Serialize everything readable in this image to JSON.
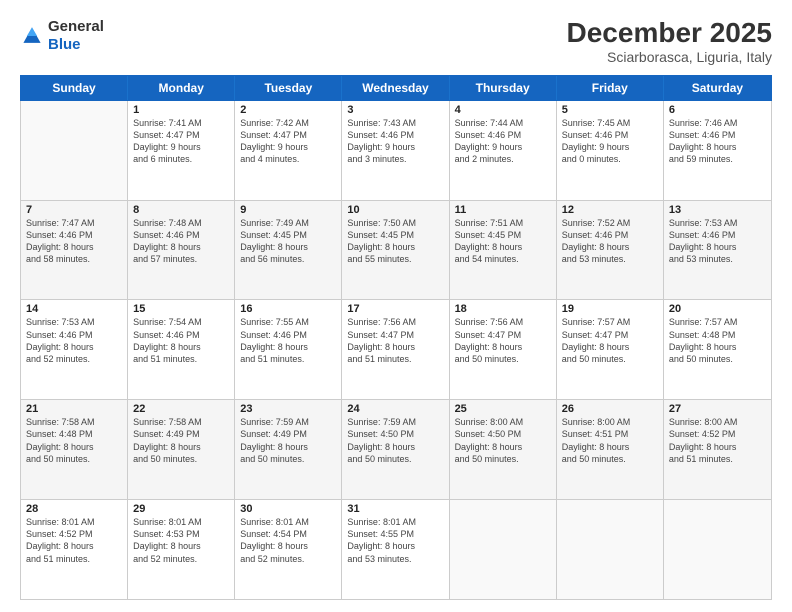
{
  "header": {
    "logo_general": "General",
    "logo_blue": "Blue",
    "month_year": "December 2025",
    "location": "Sciarborasca, Liguria, Italy"
  },
  "days_of_week": [
    "Sunday",
    "Monday",
    "Tuesday",
    "Wednesday",
    "Thursday",
    "Friday",
    "Saturday"
  ],
  "weeks": [
    [
      {
        "day": "",
        "text": "",
        "shaded": false,
        "empty": true
      },
      {
        "day": "1",
        "text": "Sunrise: 7:41 AM\nSunset: 4:47 PM\nDaylight: 9 hours\nand 6 minutes.",
        "shaded": false
      },
      {
        "day": "2",
        "text": "Sunrise: 7:42 AM\nSunset: 4:47 PM\nDaylight: 9 hours\nand 4 minutes.",
        "shaded": false
      },
      {
        "day": "3",
        "text": "Sunrise: 7:43 AM\nSunset: 4:46 PM\nDaylight: 9 hours\nand 3 minutes.",
        "shaded": false
      },
      {
        "day": "4",
        "text": "Sunrise: 7:44 AM\nSunset: 4:46 PM\nDaylight: 9 hours\nand 2 minutes.",
        "shaded": false
      },
      {
        "day": "5",
        "text": "Sunrise: 7:45 AM\nSunset: 4:46 PM\nDaylight: 9 hours\nand 0 minutes.",
        "shaded": false
      },
      {
        "day": "6",
        "text": "Sunrise: 7:46 AM\nSunset: 4:46 PM\nDaylight: 8 hours\nand 59 minutes.",
        "shaded": false
      }
    ],
    [
      {
        "day": "7",
        "text": "Sunrise: 7:47 AM\nSunset: 4:46 PM\nDaylight: 8 hours\nand 58 minutes.",
        "shaded": true
      },
      {
        "day": "8",
        "text": "Sunrise: 7:48 AM\nSunset: 4:46 PM\nDaylight: 8 hours\nand 57 minutes.",
        "shaded": true
      },
      {
        "day": "9",
        "text": "Sunrise: 7:49 AM\nSunset: 4:45 PM\nDaylight: 8 hours\nand 56 minutes.",
        "shaded": true
      },
      {
        "day": "10",
        "text": "Sunrise: 7:50 AM\nSunset: 4:45 PM\nDaylight: 8 hours\nand 55 minutes.",
        "shaded": true
      },
      {
        "day": "11",
        "text": "Sunrise: 7:51 AM\nSunset: 4:45 PM\nDaylight: 8 hours\nand 54 minutes.",
        "shaded": true
      },
      {
        "day": "12",
        "text": "Sunrise: 7:52 AM\nSunset: 4:46 PM\nDaylight: 8 hours\nand 53 minutes.",
        "shaded": true
      },
      {
        "day": "13",
        "text": "Sunrise: 7:53 AM\nSunset: 4:46 PM\nDaylight: 8 hours\nand 53 minutes.",
        "shaded": true
      }
    ],
    [
      {
        "day": "14",
        "text": "Sunrise: 7:53 AM\nSunset: 4:46 PM\nDaylight: 8 hours\nand 52 minutes.",
        "shaded": false
      },
      {
        "day": "15",
        "text": "Sunrise: 7:54 AM\nSunset: 4:46 PM\nDaylight: 8 hours\nand 51 minutes.",
        "shaded": false
      },
      {
        "day": "16",
        "text": "Sunrise: 7:55 AM\nSunset: 4:46 PM\nDaylight: 8 hours\nand 51 minutes.",
        "shaded": false
      },
      {
        "day": "17",
        "text": "Sunrise: 7:56 AM\nSunset: 4:47 PM\nDaylight: 8 hours\nand 51 minutes.",
        "shaded": false
      },
      {
        "day": "18",
        "text": "Sunrise: 7:56 AM\nSunset: 4:47 PM\nDaylight: 8 hours\nand 50 minutes.",
        "shaded": false
      },
      {
        "day": "19",
        "text": "Sunrise: 7:57 AM\nSunset: 4:47 PM\nDaylight: 8 hours\nand 50 minutes.",
        "shaded": false
      },
      {
        "day": "20",
        "text": "Sunrise: 7:57 AM\nSunset: 4:48 PM\nDaylight: 8 hours\nand 50 minutes.",
        "shaded": false
      }
    ],
    [
      {
        "day": "21",
        "text": "Sunrise: 7:58 AM\nSunset: 4:48 PM\nDaylight: 8 hours\nand 50 minutes.",
        "shaded": true
      },
      {
        "day": "22",
        "text": "Sunrise: 7:58 AM\nSunset: 4:49 PM\nDaylight: 8 hours\nand 50 minutes.",
        "shaded": true
      },
      {
        "day": "23",
        "text": "Sunrise: 7:59 AM\nSunset: 4:49 PM\nDaylight: 8 hours\nand 50 minutes.",
        "shaded": true
      },
      {
        "day": "24",
        "text": "Sunrise: 7:59 AM\nSunset: 4:50 PM\nDaylight: 8 hours\nand 50 minutes.",
        "shaded": true
      },
      {
        "day": "25",
        "text": "Sunrise: 8:00 AM\nSunset: 4:50 PM\nDaylight: 8 hours\nand 50 minutes.",
        "shaded": true
      },
      {
        "day": "26",
        "text": "Sunrise: 8:00 AM\nSunset: 4:51 PM\nDaylight: 8 hours\nand 50 minutes.",
        "shaded": true
      },
      {
        "day": "27",
        "text": "Sunrise: 8:00 AM\nSunset: 4:52 PM\nDaylight: 8 hours\nand 51 minutes.",
        "shaded": true
      }
    ],
    [
      {
        "day": "28",
        "text": "Sunrise: 8:01 AM\nSunset: 4:52 PM\nDaylight: 8 hours\nand 51 minutes.",
        "shaded": false
      },
      {
        "day": "29",
        "text": "Sunrise: 8:01 AM\nSunset: 4:53 PM\nDaylight: 8 hours\nand 52 minutes.",
        "shaded": false
      },
      {
        "day": "30",
        "text": "Sunrise: 8:01 AM\nSunset: 4:54 PM\nDaylight: 8 hours\nand 52 minutes.",
        "shaded": false
      },
      {
        "day": "31",
        "text": "Sunrise: 8:01 AM\nSunset: 4:55 PM\nDaylight: 8 hours\nand 53 minutes.",
        "shaded": false
      },
      {
        "day": "",
        "text": "",
        "shaded": false,
        "empty": true
      },
      {
        "day": "",
        "text": "",
        "shaded": false,
        "empty": true
      },
      {
        "day": "",
        "text": "",
        "shaded": false,
        "empty": true
      }
    ]
  ]
}
